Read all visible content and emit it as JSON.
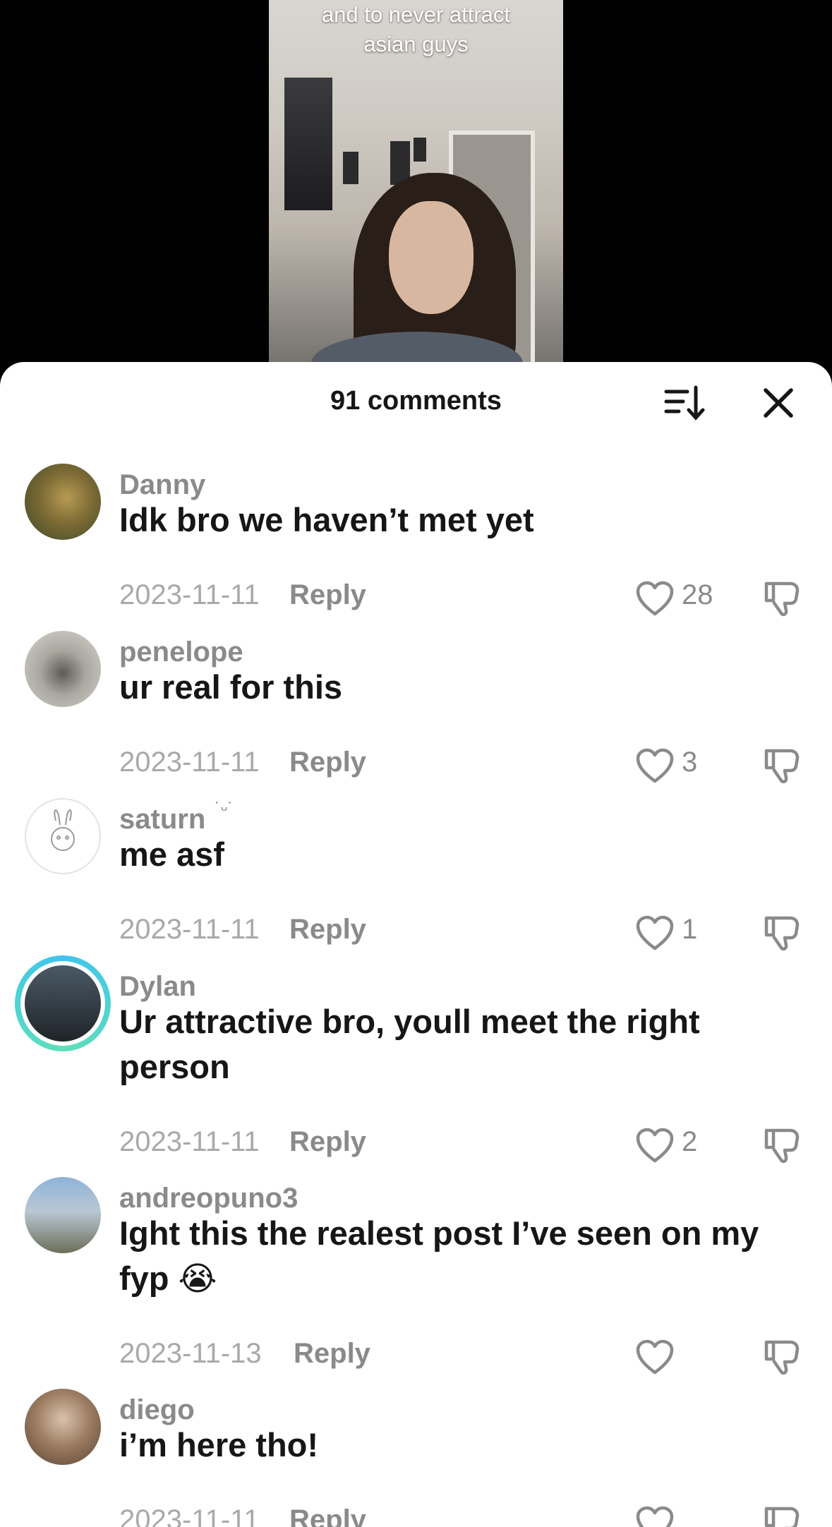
{
  "video": {
    "caption_line1": "and to never attract",
    "caption_line2": "asian guys"
  },
  "sheet": {
    "comment_count_label": "91 comments",
    "sort_icon": "sort-icon",
    "close_icon": "close-icon"
  },
  "comments": [
    {
      "username": "Danny",
      "text": "Idk bro we haven’t met yet",
      "date": "2023-11-11",
      "reply": "Reply",
      "likes": "28"
    },
    {
      "username": "penelope",
      "text": "ur real for this",
      "date": "2023-11-11",
      "reply": "Reply",
      "likes": "3"
    },
    {
      "username": "saturn",
      "username_deco": "˙ᵕ˙",
      "text": "me asf",
      "date": "2023-11-11",
      "reply": "Reply",
      "likes": "1"
    },
    {
      "username": "Dylan",
      "text": "Ur attractive bro, youll meet the right person",
      "date": "2023-11-11",
      "reply": "Reply",
      "likes": "2"
    },
    {
      "username": "andreopuno3",
      "text": "Ight this the realest post I’ve seen on my fyp 😭",
      "date": "2023-11-13",
      "reply": "Reply",
      "likes": ""
    },
    {
      "username": "diego",
      "text": "i’m here tho!",
      "date": "2023-11-11",
      "reply": "Reply",
      "likes": ""
    }
  ]
}
